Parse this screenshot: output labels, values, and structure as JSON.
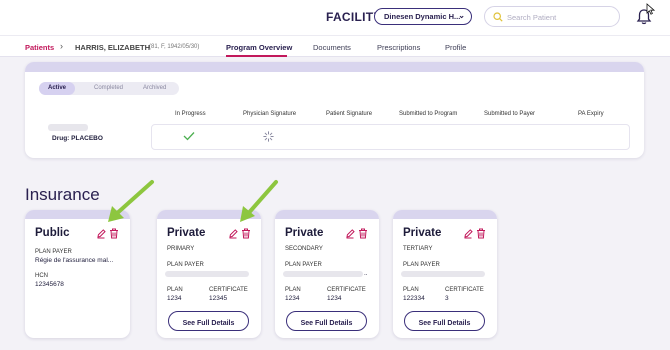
{
  "header": {
    "facility_label": "FACILITY",
    "facility_value": "Dinesen Dynamic H...",
    "search_placeholder": "Search Patient"
  },
  "breadcrumb": {
    "patients": "Patients",
    "patient_name": "HARRIS, ELIZABETH",
    "patient_meta": "(81, F, 1942/05/30)"
  },
  "tabs": [
    {
      "label": "Program Overview",
      "active": true
    },
    {
      "label": "Documents"
    },
    {
      "label": "Prescriptions"
    },
    {
      "label": "Profile"
    }
  ],
  "program": {
    "filters": [
      "Active",
      "Completed",
      "Archived"
    ],
    "columns": [
      "In Progress",
      "Physician Signature",
      "Patient Signature",
      "Submitted to Program",
      "Submitted to Payer",
      "PA Expiry"
    ],
    "drug_label": "Drug: PLACEBO"
  },
  "insurance": {
    "title": "Insurance",
    "details_label": "See Full Details",
    "cards": [
      {
        "type": "Public",
        "plan_payer_label": "PLAN PAYER",
        "plan_payer_value": "Régie de l'assurance mal...",
        "hcn_label": "HCN",
        "hcn_value": "12345678"
      },
      {
        "type": "Private",
        "rank": "PRIMARY",
        "plan_payer_label": "PLAN PAYER",
        "plan_label": "PLAN",
        "plan_value": "1234",
        "certificate_label": "CERTIFICATE",
        "certificate_value": "12345"
      },
      {
        "type": "Private",
        "rank": "SECONDARY",
        "plan_payer_label": "PLAN PAYER",
        "plan_payer_suffix": "..",
        "plan_label": "PLAN",
        "plan_value": "1234",
        "certificate_label": "CERTIFICATE",
        "certificate_value": "1234"
      },
      {
        "type": "Private",
        "rank": "TERTIARY",
        "plan_payer_label": "PLAN PAYER",
        "plan_label": "PLAN",
        "plan_value": "122334",
        "certificate_label": "CERTIFICATE",
        "certificate_value": "3"
      }
    ]
  },
  "colors": {
    "accent": "#c2185b",
    "brand": "#2a2150",
    "band": "#d9d5ee",
    "arrow": "#8dc63f"
  },
  "icons": [
    "search-icon",
    "bell-icon",
    "chevron-down-icon",
    "check-icon",
    "spinner-icon",
    "edit-icon",
    "trash-icon",
    "arrow-annotation",
    "cursor-icon"
  ]
}
